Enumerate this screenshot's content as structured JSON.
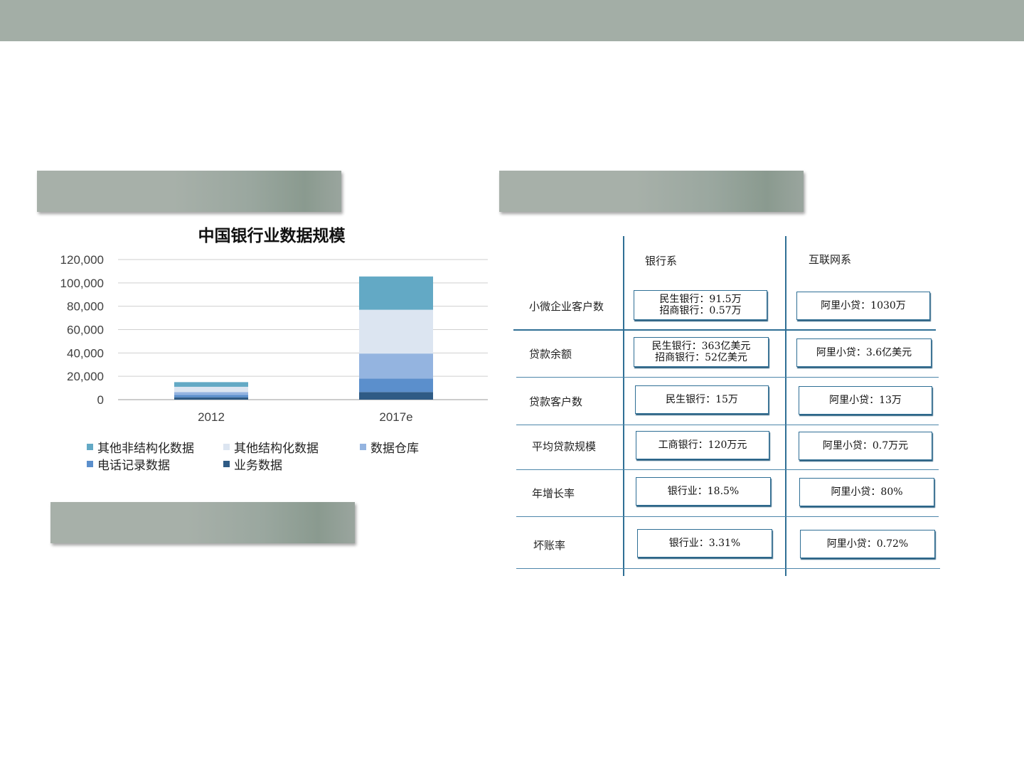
{
  "colors": {
    "header_bar": "#a3aea6",
    "banner": "#9ea9a1",
    "table_line": "#2f6f95"
  },
  "chart_data": {
    "type": "bar",
    "stacked": true,
    "title": "中国银行业数据规模",
    "categories": [
      "2012",
      "2017e"
    ],
    "ylim": [
      0,
      120000
    ],
    "yticks": [
      "0",
      "20,000",
      "40,000",
      "60,000",
      "80,000",
      "100,000",
      "120,000"
    ],
    "grid": true,
    "legend_position": "bottom",
    "series": [
      {
        "name": "业务数据",
        "color": "#2f5b85",
        "values": [
          2000,
          6500
        ]
      },
      {
        "name": "电话记录数据",
        "color": "#5b8fcc",
        "values": [
          2000,
          11500
        ]
      },
      {
        "name": "数据仓库",
        "color": "#94b4e0",
        "values": [
          2500,
          21500
        ]
      },
      {
        "name": "其他结构化数据",
        "color": "#dce5f1",
        "values": [
          4500,
          37500
        ]
      },
      {
        "name": "其他非结构化数据",
        "color": "#63a9c5",
        "values": [
          4000,
          28500
        ]
      }
    ],
    "legend_order": [
      "其他非结构化数据",
      "其他结构化数据",
      "数据仓库",
      "电话记录数据",
      "业务数据"
    ]
  },
  "table": {
    "headers": [
      "银行系",
      "互联网系"
    ],
    "rows": [
      {
        "label": "小微企业客户数",
        "bank": [
          "民生银行：91.5万",
          "招商银行：0.57万"
        ],
        "internet": [
          "阿里小贷：1030万"
        ]
      },
      {
        "label": "贷款余额",
        "bank": [
          "民生银行：363亿美元",
          "招商银行：52亿美元"
        ],
        "internet": [
          "阿里小贷：3.6亿美元"
        ]
      },
      {
        "label": "贷款客户数",
        "bank": [
          "民生银行：15万"
        ],
        "internet": [
          "阿里小贷：13万"
        ]
      },
      {
        "label": "平均贷款规模",
        "bank": [
          "工商银行：120万元"
        ],
        "internet": [
          "阿里小贷：0.7万元"
        ]
      },
      {
        "label": "年增长率",
        "bank": [
          "银行业：18.5%"
        ],
        "internet": [
          "阿里小贷：80%"
        ]
      },
      {
        "label": "坏账率",
        "bank": [
          "银行业：3.31%"
        ],
        "internet": [
          "阿里小贷：0.72%"
        ]
      }
    ]
  }
}
